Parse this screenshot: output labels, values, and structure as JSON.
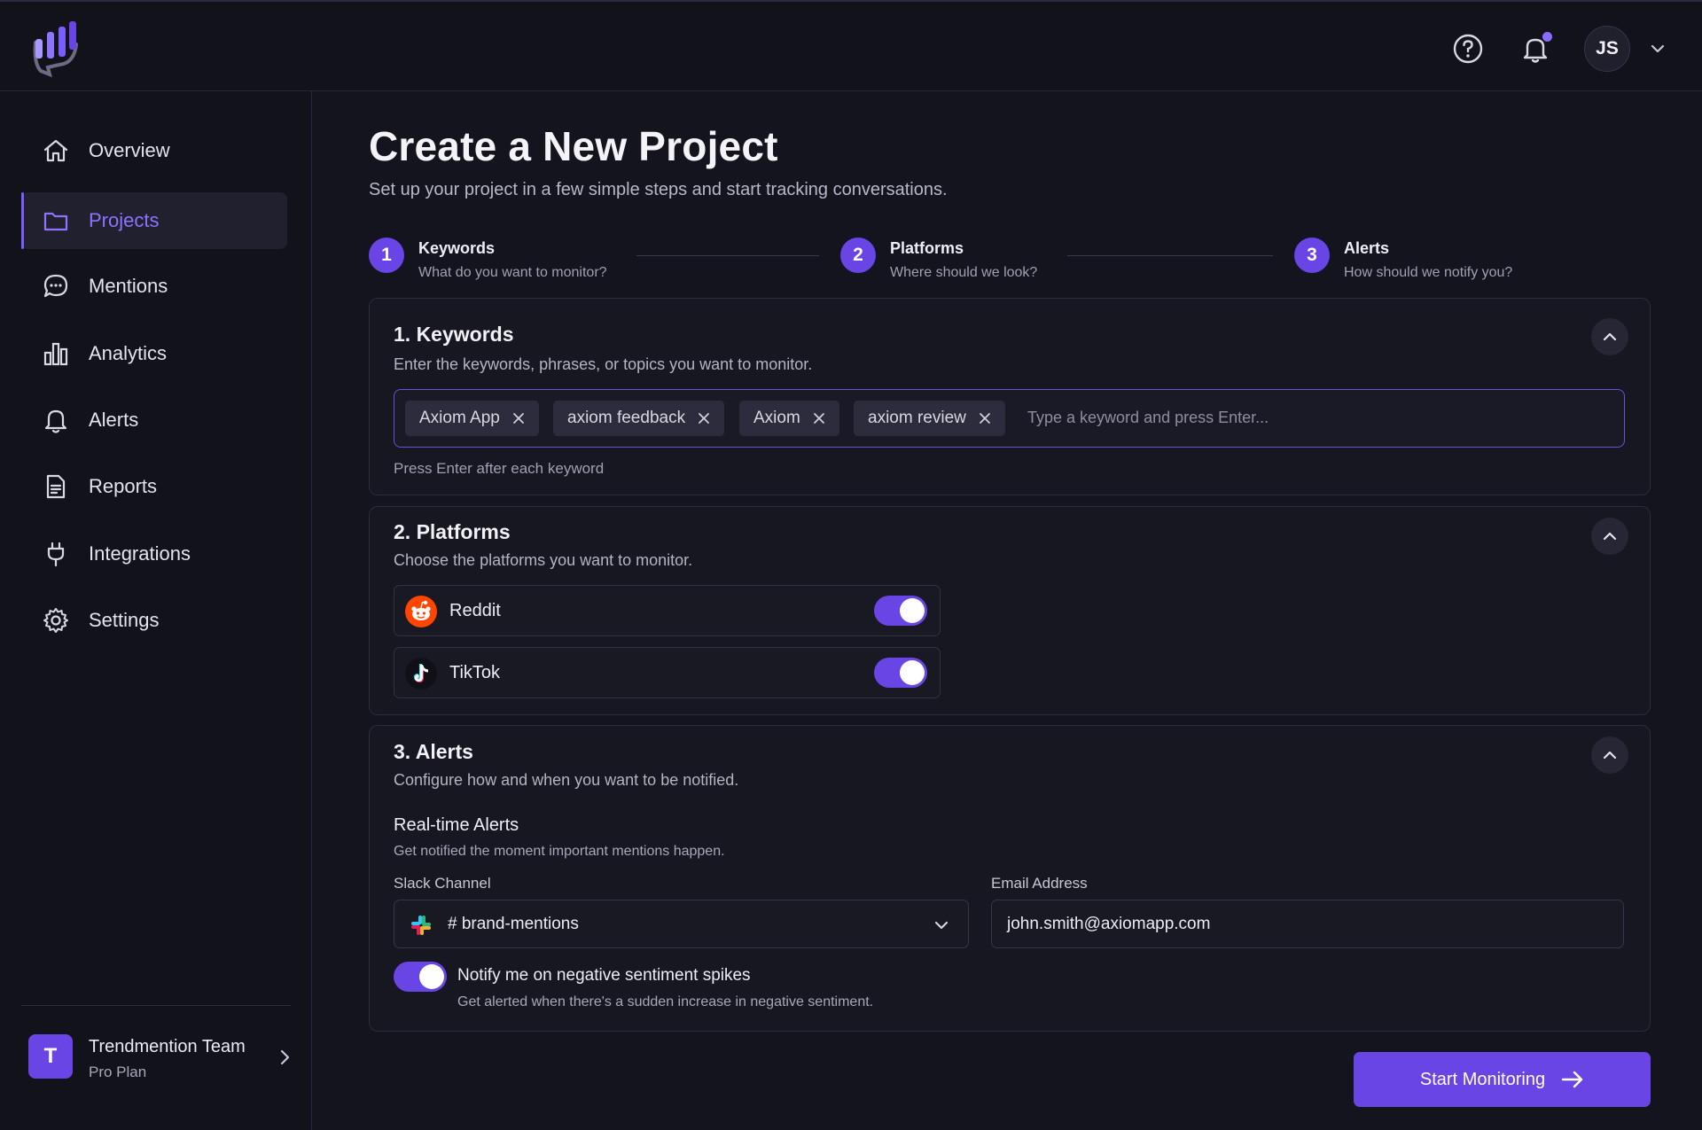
{
  "header": {
    "user_initials": "JS"
  },
  "sidebar": {
    "items": [
      {
        "label": "Overview",
        "icon": "home-icon"
      },
      {
        "label": "Projects",
        "icon": "folder-icon"
      },
      {
        "label": "Mentions",
        "icon": "chat-icon"
      },
      {
        "label": "Analytics",
        "icon": "bar-chart-icon"
      },
      {
        "label": "Alerts",
        "icon": "bell-icon"
      },
      {
        "label": "Reports",
        "icon": "document-icon"
      },
      {
        "label": "Integrations",
        "icon": "plug-icon"
      },
      {
        "label": "Settings",
        "icon": "gear-icon"
      }
    ],
    "active_index": 1,
    "team": {
      "initial": "T",
      "name": "Trendmention Team",
      "plan": "Pro Plan"
    }
  },
  "page": {
    "title": "Create a New Project",
    "subtitle": "Set up your project in a few simple steps and start tracking conversations."
  },
  "steps": [
    {
      "num": "1",
      "title": "Keywords",
      "desc": "What do you want to monitor?"
    },
    {
      "num": "2",
      "title": "Platforms",
      "desc": "Where should we look?"
    },
    {
      "num": "3",
      "title": "Alerts",
      "desc": "How should we notify you?"
    }
  ],
  "keywords": {
    "title": "1. Keywords",
    "desc": "Enter the keywords, phrases, or topics you want to monitor.",
    "chips": [
      "Axiom App",
      "axiom feedback",
      "Axiom",
      "axiom review"
    ],
    "placeholder": "Type a keyword and press Enter...",
    "hint": "Press Enter after each keyword"
  },
  "platforms": {
    "title": "2. Platforms",
    "desc": "Choose the platforms you want to monitor.",
    "items": [
      {
        "name": "Reddit",
        "enabled": true
      },
      {
        "name": "TikTok",
        "enabled": true
      }
    ]
  },
  "alerts": {
    "title": "3. Alerts",
    "desc": "Configure how and when you want to be notified.",
    "realtime_title": "Real-time Alerts",
    "realtime_desc": "Get notified the moment important mentions happen.",
    "slack_label": "Slack Channel",
    "slack_value": "# brand-mentions",
    "email_label": "Email Address",
    "email_value": "john.smith@axiomapp.com",
    "sentiment_title": "Notify me on negative sentiment spikes",
    "sentiment_desc": "Get alerted when there's a sudden increase in negative sentiment.",
    "sentiment_enabled": true
  },
  "actions": {
    "start_label": "Start Monitoring"
  },
  "colors": {
    "accent": "#6a45e6",
    "background": "#14141f",
    "reddit": "#ff4500"
  }
}
